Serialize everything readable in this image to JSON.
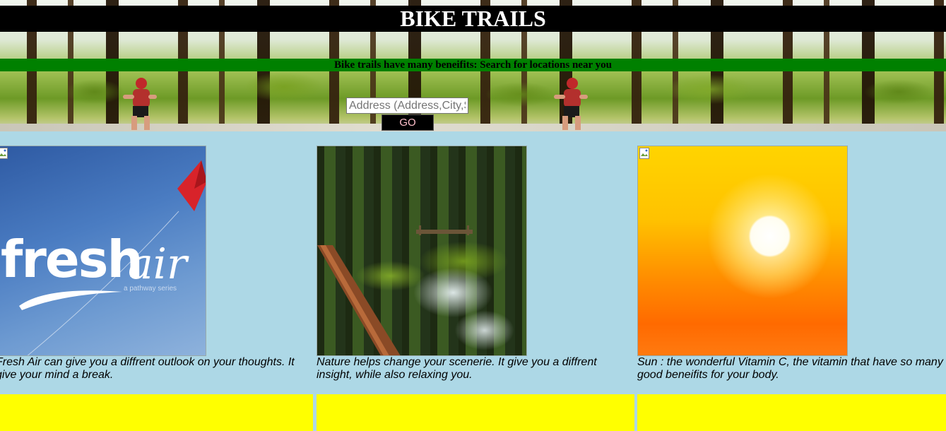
{
  "header": {
    "title": "BIKE TRAILS",
    "tagline": "Bike trails have many beneifits: Search for locations near you"
  },
  "search": {
    "placeholder": "Address (Address,City,State)",
    "button_label": "GO"
  },
  "cards": [
    {
      "image_text": {
        "word1": "fresh",
        "word2": "air",
        "small": "a pathway series"
      },
      "caption": "Fresh Air can give you a diffrent outlook on your thoughts. It give your mind a break."
    },
    {
      "caption": "Nature helps change your scenerie. It give you a diffrent insight, while also relaxing you."
    },
    {
      "caption": "Sun : the wonderful Vitamin C, the vitamin that have so many good beneifits for your body."
    }
  ],
  "colors": {
    "page_background": "#add8e6",
    "title_bar": "#000000",
    "tagline_bar": "#008000",
    "button_text": "#ffc0cb",
    "footer_boxes": "#ffff00"
  }
}
